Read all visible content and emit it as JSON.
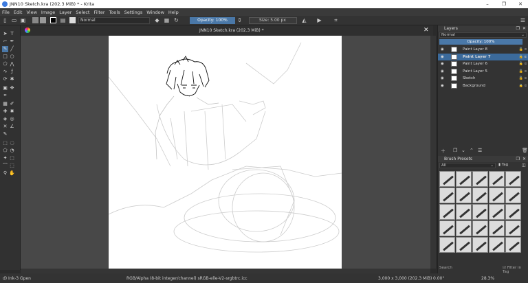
{
  "window": {
    "title": "JNN10 Sketch.kra (202.3 MiB) * - Krita"
  },
  "menu": [
    "File",
    "Edit",
    "View",
    "Image",
    "Layer",
    "Select",
    "Filter",
    "Tools",
    "Settings",
    "Window",
    "Help"
  ],
  "toolbar": {
    "blend_mode": "Normal",
    "opacity": "Opacity: 100%",
    "size": "Size: 5.00 px"
  },
  "document": {
    "tab_title": "JNN10 Sketch.kra (202.3 MiB) *"
  },
  "layers_panel": {
    "title": "Layers",
    "blend_mode": "Normal",
    "opacity": "Opacity:  100%",
    "layers": [
      {
        "name": "Paint Layer 8",
        "selected": false
      },
      {
        "name": "Paint Layer 7",
        "selected": true
      },
      {
        "name": "Paint Layer 6",
        "selected": false
      },
      {
        "name": "Paint Layer 5",
        "selected": false
      },
      {
        "name": "Sketch",
        "selected": false
      },
      {
        "name": "Background",
        "selected": false
      }
    ]
  },
  "brush_presets": {
    "title": "Brush Presets",
    "filter": "All",
    "tag_label": "Tag",
    "search_placeholder": "Search",
    "filter_in_tag": "Filter in Tag"
  },
  "status": {
    "brush": "d) Ink-3 Gpen",
    "color_info": "RGB/Alpha (8-bit integer/channel)  sRGB-elle-V2-srgbtrc.icc",
    "image_size": "3,000 x 3,000 (202.3 MiB)",
    "rotation": "0.00°",
    "zoom": "28.3%"
  }
}
